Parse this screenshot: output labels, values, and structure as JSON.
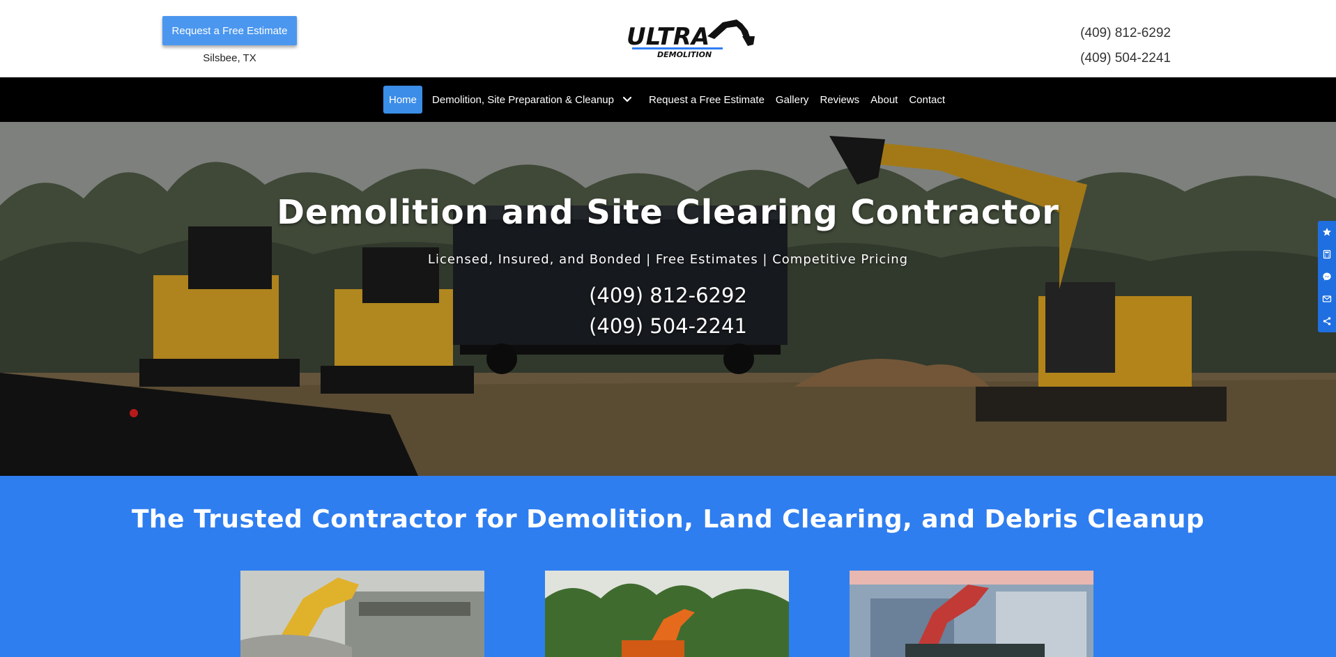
{
  "header": {
    "estimate_button": "Request a Free Estimate",
    "location": "Silsbee, TX",
    "logo_text": "ULTRA",
    "logo_subtext": "DEMOLITION",
    "phones": [
      "(409) 812-6292",
      "(409) 504-2241"
    ]
  },
  "nav": {
    "items": [
      {
        "label": "Home",
        "active": true
      },
      {
        "label": "Demolition, Site Preparation & Cleanup",
        "has_dropdown": true
      },
      {
        "label": "Request a Free Estimate"
      },
      {
        "label": "Gallery"
      },
      {
        "label": "Reviews"
      },
      {
        "label": "About"
      },
      {
        "label": "Contact"
      }
    ]
  },
  "hero": {
    "title": "Demolition and Site Clearing Contractor",
    "subtitle": "Licensed, Insured, and Bonded | Free Estimates | Competitive Pricing",
    "phones": [
      "(409) 812-6292",
      "(409) 504-2241"
    ]
  },
  "side_bar": {
    "icons": [
      "star-icon",
      "calculator-icon",
      "messenger-icon",
      "mail-icon",
      "share-icon"
    ]
  },
  "section": {
    "title": "The Trusted Contractor for Demolition, Land Clearing, and Debris Cleanup"
  },
  "colors": {
    "nav_bg": "#000000",
    "accent_blue": "#2f7ef0",
    "button_blue": "#4b97ef",
    "active_nav": "#3b8de8",
    "machine_yellow": "#d9a21f"
  }
}
